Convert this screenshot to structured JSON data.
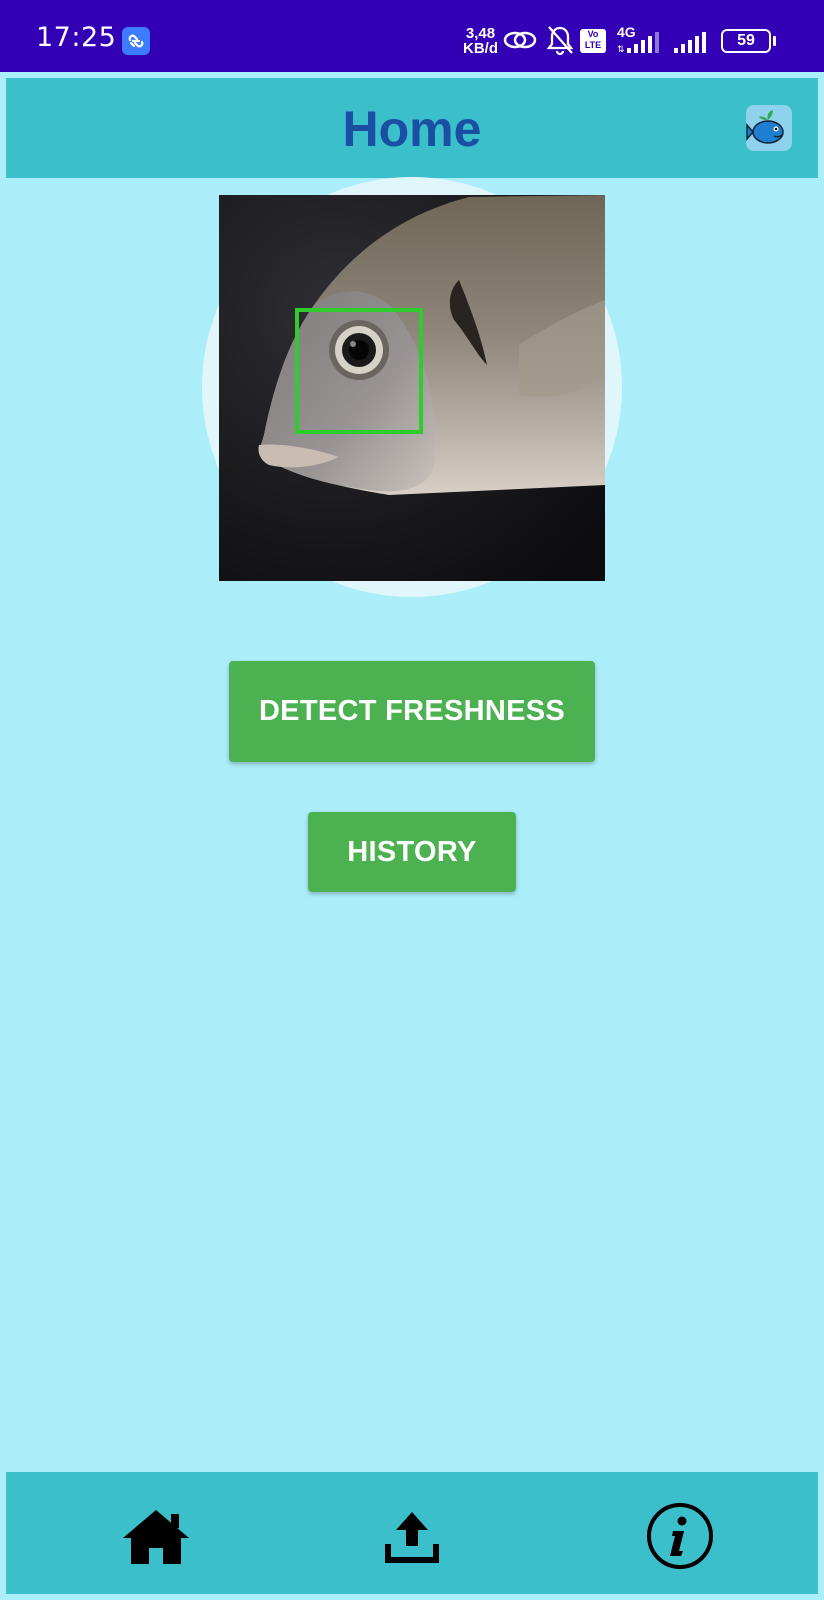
{
  "status_bar": {
    "time": "17:25",
    "net_speed_value": "3,48",
    "net_speed_unit": "KB/d",
    "network_type": "4G",
    "volte_top": "Vo",
    "volte_bottom": "LTE",
    "battery": "59"
  },
  "header": {
    "title": "Home",
    "logo_icon": "fish-logo-icon"
  },
  "main": {
    "image_icon": "fish-photo",
    "detection_box_color": "#2ecc2e"
  },
  "buttons": {
    "detect_label": "DETECT FRESHNESS",
    "history_label": "HISTORY"
  },
  "bottom_nav": {
    "items": [
      {
        "icon": "home-icon"
      },
      {
        "icon": "upload-icon"
      },
      {
        "icon": "info-icon"
      }
    ]
  },
  "colors": {
    "status_bar": "#3400b5",
    "header": "#3bbfcb",
    "background": "#abeefa",
    "button": "#4cb151",
    "title": "#1a4fa3"
  }
}
